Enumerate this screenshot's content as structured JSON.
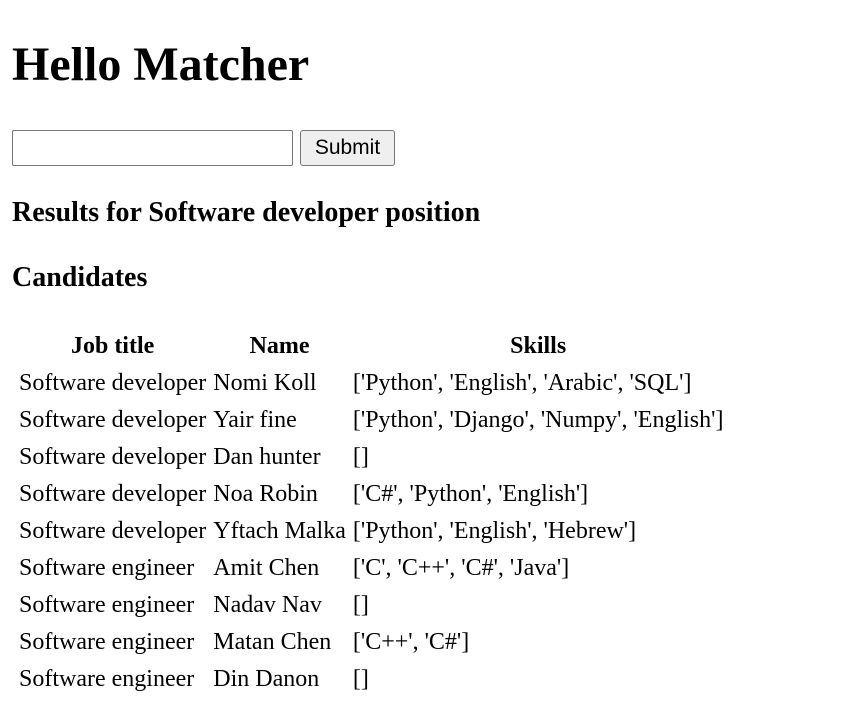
{
  "page": {
    "title": "Hello Matcher"
  },
  "form": {
    "input_value": "",
    "submit_label": "Submit"
  },
  "results": {
    "heading": "Results for Software developer position"
  },
  "candidates": {
    "heading": "Candidates",
    "columns": [
      "Job title",
      "Name",
      "Skills"
    ],
    "rows": [
      {
        "job_title": "Software developer",
        "name": "Nomi Koll",
        "skills": "['Python', 'English', 'Arabic', 'SQL']"
      },
      {
        "job_title": "Software developer",
        "name": "Yair fine",
        "skills": "['Python', 'Django', 'Numpy', 'English']"
      },
      {
        "job_title": "Software developer",
        "name": "Dan hunter",
        "skills": "[]"
      },
      {
        "job_title": "Software developer",
        "name": "Noa Robin",
        "skills": "['C#', 'Python', 'English']"
      },
      {
        "job_title": "Software developer",
        "name": "Yftach Malka",
        "skills": "['Python', 'English', 'Hebrew']"
      },
      {
        "job_title": "Software engineer",
        "name": "Amit Chen",
        "skills": "['C', 'C++', 'C#', 'Java']"
      },
      {
        "job_title": "Software engineer",
        "name": "Nadav Nav",
        "skills": "[]"
      },
      {
        "job_title": "Software engineer",
        "name": "Matan Chen",
        "skills": "['C++', 'C#']"
      },
      {
        "job_title": "Software engineer",
        "name": "Din Danon",
        "skills": "[]"
      }
    ]
  }
}
